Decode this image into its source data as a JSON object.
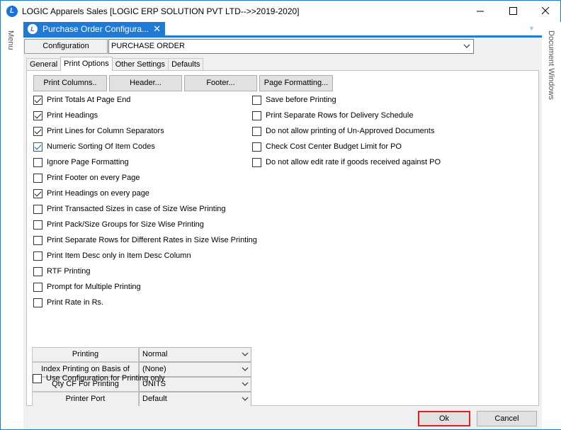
{
  "window": {
    "title": "LOGIC Apparels Sales  [LOGIC ERP SOLUTION PVT LTD-->>2019-2020]",
    "logo_letter": "L",
    "accent_color": "#1f7ad6",
    "minimize_icon": "minimize-icon",
    "maximize_icon": "maximize-icon",
    "close_icon": "close-icon"
  },
  "side_panels": {
    "left": "Menu",
    "right": "Document Windows"
  },
  "document_tab": {
    "label": "Purchase Order Configura...",
    "close_glyph": "✕"
  },
  "configuration": {
    "label": "Configuration",
    "selected_value": "PURCHASE ORDER"
  },
  "tabs": [
    {
      "label": "General",
      "active": false
    },
    {
      "label": "Print Options",
      "active": true
    },
    {
      "label": "Other Settings",
      "active": false
    },
    {
      "label": "Defaults",
      "active": false
    }
  ],
  "print_buttons": [
    "Print Columns..",
    "Header...",
    "Footer...",
    "Page Formatting..."
  ],
  "left_options": [
    {
      "label": "Print Totals At Page End",
      "checked": true
    },
    {
      "label": "Print Headings",
      "checked": true
    },
    {
      "label": "Print Lines for Column Separators",
      "checked": true
    },
    {
      "label": "Numeric Sorting Of Item Codes",
      "checked": true
    },
    {
      "label": "Ignore Page Formatting",
      "checked": false
    },
    {
      "label": "Print Footer on every Page",
      "checked": false
    },
    {
      "label": "Print Headings on every page",
      "checked": true
    },
    {
      "label": "Print Transacted Sizes in case of Size Wise Printing",
      "checked": false
    },
    {
      "label": "Print Pack/Size Groups for Size Wise Printing",
      "checked": false
    },
    {
      "label": "Print Separate Rows for Different Rates in Size Wise Printing",
      "checked": false
    },
    {
      "label": "Print Item Desc only in Item Desc Column",
      "checked": false
    },
    {
      "label": "RTF Printing",
      "checked": false
    },
    {
      "label": "Prompt for Multiple Printing",
      "checked": false
    },
    {
      "label": "Print Rate in Rs.",
      "checked": false
    }
  ],
  "right_options": [
    {
      "label": "Save before Printing",
      "checked": false
    },
    {
      "label": "Print Separate Rows for Delivery Schedule",
      "checked": false
    },
    {
      "label": "Do not allow printing of Un-Approved Documents",
      "checked": false
    },
    {
      "label": "Check Cost Center Budget Limit for PO",
      "checked": false
    },
    {
      "label": "Do not allow edit rate if goods received against PO",
      "checked": false
    }
  ],
  "properties": [
    {
      "label": "Printing",
      "value": "Normal"
    },
    {
      "label": "Index Printing on Basis of",
      "value": "(None)"
    },
    {
      "label": "Qty CF For Printing",
      "value": "UNITS"
    },
    {
      "label": "Printer Port",
      "value": "Default"
    }
  ],
  "bottom_option": {
    "label": "Use Configuration for Printing only",
    "checked": false
  },
  "dialog_buttons": {
    "ok": "Ok",
    "cancel": "Cancel"
  }
}
